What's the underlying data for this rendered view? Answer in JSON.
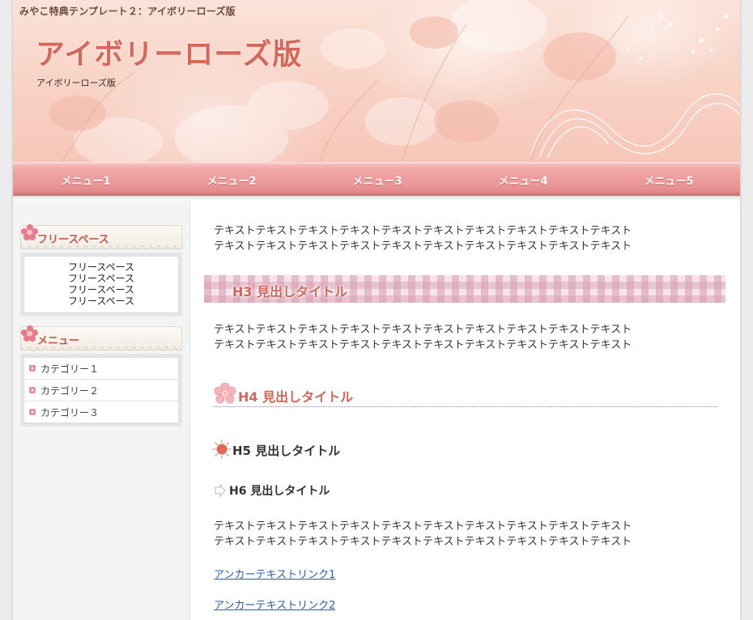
{
  "header": {
    "caption": "みやこ特典テンプレート２：アイボリーローズ版",
    "site_title": "アイボリーローズ版",
    "site_subtitle": "アイボリーローズ版"
  },
  "nav": {
    "items": [
      {
        "label": "メニュー1"
      },
      {
        "label": "メニュー2"
      },
      {
        "label": "メニュー3"
      },
      {
        "label": "メニュー4"
      },
      {
        "label": "メニュー5"
      }
    ]
  },
  "sidebar": {
    "free_space": {
      "title": "フリースペース",
      "lines": [
        "フリースペース",
        "フリースペース",
        "フリースペース",
        "フリースペース"
      ]
    },
    "menu": {
      "title": "メニュー",
      "categories": [
        {
          "label": "カテゴリー１"
        },
        {
          "label": "カテゴリー２"
        },
        {
          "label": "カテゴリー３"
        }
      ]
    }
  },
  "main": {
    "para1": [
      "テキストテキストテキストテキストテキストテキストテキストテキストテキストテキスト",
      "テキストテキストテキストテキストテキストテキストテキストテキストテキストテキスト"
    ],
    "h3": "H3 見出しタイトル",
    "para2": [
      "テキストテキストテキストテキストテキストテキストテキストテキストテキストテキスト",
      "テキストテキストテキストテキストテキストテキストテキストテキストテキストテキスト"
    ],
    "h4": "H4 見出しタイトル",
    "h5": "H5 見出しタイトル",
    "h6": "H6 見出しタイトル",
    "para3": [
      "テキストテキストテキストテキストテキストテキストテキストテキストテキストテキスト",
      "テキストテキストテキストテキストテキストテキストテキストテキストテキストテキスト"
    ],
    "links": [
      {
        "label": "アンカーテキストリンク1"
      },
      {
        "label": "アンカーテキストリンク2"
      }
    ]
  },
  "colors": {
    "accent": "#d7675a",
    "nav": "#ec9a9a",
    "link": "#2a5fa0"
  },
  "icons": {
    "widget": "flower-icon",
    "category_bullet": "arrow-bullet-icon",
    "h4": "rose-icon",
    "h5": "sun-icon",
    "h6": "arrow-icon"
  }
}
